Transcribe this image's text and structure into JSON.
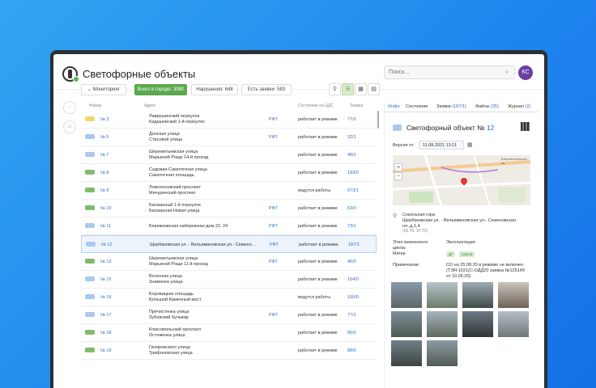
{
  "app": {
    "title": "Светофорные объекты",
    "search_placeholder": "Поиск...",
    "avatar": "КС"
  },
  "toolbar": {
    "monitoring": "Мониторинг",
    "total": "Всего в городе: 3080",
    "violations": "Нарушения: 648",
    "all_requests": "Есть заявки: 583"
  },
  "table": {
    "columns": [
      "Номер",
      "Адрес",
      "Состояние на ЦДС",
      "Заявки"
    ],
    "rows": [
      {
        "num": "№ 3",
        "addr1": "Лаврушинский переулок",
        "addr2": "Кадашевский 1-й переулок",
        "type": "РФТ",
        "state": "работает в режиме",
        "req": "77/2",
        "badge": "#f0d96a"
      },
      {
        "num": "№ 5",
        "addr1": "Донская улица",
        "addr2": "Стасовой улица",
        "type": "РФТ",
        "state": "работает в режиме",
        "req": "32/1",
        "badge": "#a9c9ec"
      },
      {
        "num": "№ 7",
        "addr1": "Шереметьевская улица",
        "addr2": "Марьиной Рощи 14-й проезд",
        "type": "",
        "state": "работает в режиме",
        "req": "48/1",
        "badge": "#a9c9ec"
      },
      {
        "num": "№ 8",
        "addr1": "Садовая-Самотечная улица",
        "addr2": "Самотечная площадь",
        "type": "",
        "state": "работает в режиме",
        "req": "183/0",
        "badge": "#7dbd6c"
      },
      {
        "num": "№ 9",
        "addr1": "Ломоносовский проспект",
        "addr2": "Мичуринский проспект",
        "type": "",
        "state": "ведутся работы",
        "req": "673/1",
        "badge": "#7dbd6c"
      },
      {
        "num": "№ 10",
        "addr1": "Басманный 1-й переулок",
        "addr2": "Басманная Новая улица",
        "type": "РФТ",
        "state": "работает в режиме",
        "req": "63/0",
        "badge": "#7dbd6c"
      },
      {
        "num": "№ 11",
        "addr1": "Бережковская набережная дом 22, 24",
        "addr2": "",
        "type": "РФТ",
        "state": "работает в режиме",
        "req": "73/1",
        "badge": "#a9c9ec"
      },
      {
        "num": "№ 12",
        "addr1": "Щербаковская ул. - Вельяминовская ул.- Семено…",
        "addr2": "",
        "type": "РФТ",
        "state": "работает в режиме",
        "req": "187/1",
        "badge": "#a9c9ec"
      },
      {
        "num": "№ 13",
        "addr1": "Шереметьевская улица",
        "addr2": "Марьиной Рощи 11-й проезд",
        "type": "РФТ",
        "state": "работает в режиме",
        "req": "46/0",
        "badge": "#7dbd6c"
      },
      {
        "num": "№ 15",
        "addr1": "Волхонка улица",
        "addr2": "Знаменка улица",
        "type": "",
        "state": "работает в режиме",
        "req": "164/0",
        "badge": "#a9c9ec"
      },
      {
        "num": "№ 16",
        "addr1": "Боровицкая площадь",
        "addr2": "Большой Каменный мост",
        "type": "",
        "state": "ведутся работы",
        "req": "150/0",
        "badge": "#a9c9ec"
      },
      {
        "num": "№ 17",
        "addr1": "Пречистенка улица",
        "addr2": "Зубовский бульвар",
        "type": "РФТ",
        "state": "работает в режиме",
        "req": "77/1",
        "badge": "#a9c9ec"
      },
      {
        "num": "№ 18",
        "addr1": "Комсомольский проспект",
        "addr2": "Остоженка улица",
        "type": "",
        "state": "работает в режиме",
        "req": "85/0",
        "badge": "#7dbd6c"
      },
      {
        "num": "№ 19",
        "addr1": "Гиляровского улица",
        "addr2": "Трифоновская улица",
        "type": "",
        "state": "работает в режиме",
        "req": "88/0",
        "badge": "#7dbd6c"
      }
    ]
  },
  "panel": {
    "tabs": [
      {
        "label": "Инфо",
        "count": ""
      },
      {
        "label": "Состояние",
        "count": ""
      },
      {
        "label": "Заявки",
        "count": "(187/1)"
      },
      {
        "label": "Файлы",
        "count": "(25)"
      },
      {
        "label": "Журнал",
        "count": "(2)"
      }
    ],
    "object_title": "Светофорный объект №",
    "object_num": "12",
    "version_label": "Версия от",
    "version_value": "11.08.2021 13:11",
    "map": {
      "label": "Шереметьевская ул."
    },
    "location": {
      "line1": "Сокольная гора",
      "line2": "Щербаковская ул. - Вельяминовская ул.- Семеновская",
      "line3": "пл.,д.1,4",
      "coords": "(55.76, 37.72)"
    },
    "lifecycle_label": "Этап жизненного цикла:",
    "lifecycle_value": "Эксплуатация",
    "tags_label": "Метки",
    "tags": [
      "ДГ",
      "школа"
    ],
    "note_label": "Примечание:",
    "note_line1": "СО на 25.08.20 в режиме не включен",
    "note_line2": "(ТЭЯ-1021(С-ОДД20 заявка №125149",
    "note_line3": "от 10.06.20)"
  },
  "icons": {
    "logo": "traffic-light-icon",
    "search": "search-icon",
    "chat": "chat-icon",
    "trash": "trash-icon",
    "map_pin": "map-pin-icon",
    "list": "list-icon",
    "grid": "grid-icon",
    "qr": "qr-code-icon",
    "calendar": "calendar-icon"
  }
}
